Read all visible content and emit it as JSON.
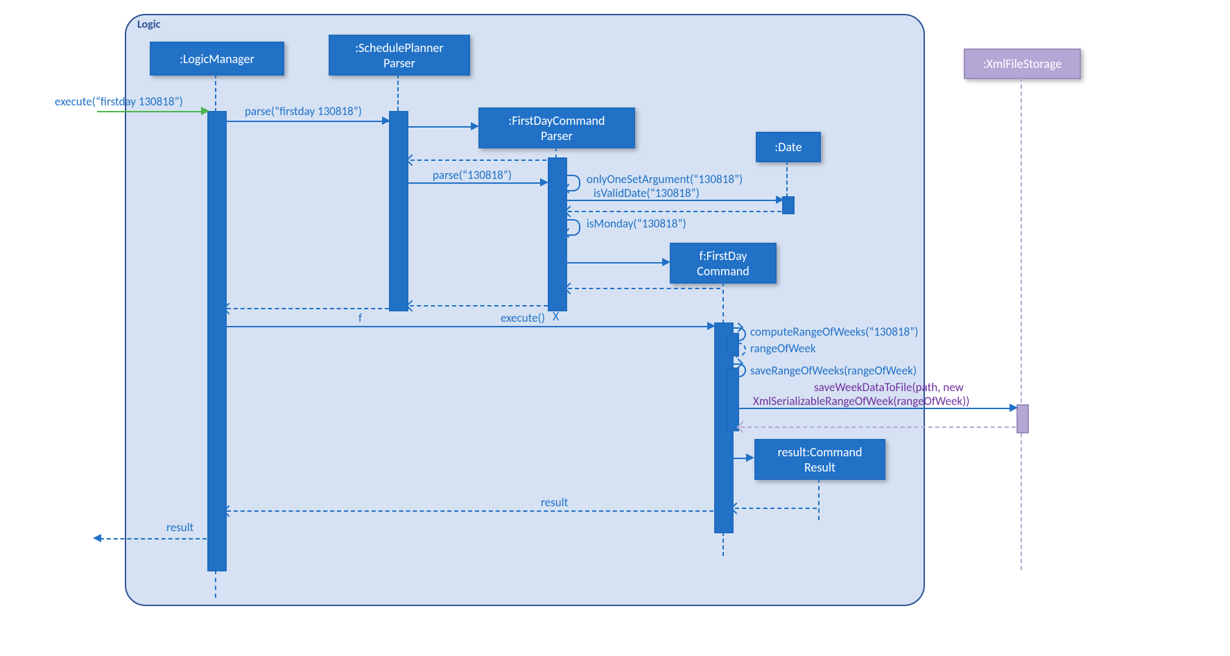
{
  "package": {
    "label": "Logic"
  },
  "lifelines": {
    "lm": ":LogicManager",
    "spp": ":SchedulePlanner\nParser",
    "fdcp": ":FirstDayCommand\nParser",
    "date": ":Date",
    "fdc": "f:FirstDay\nCommand",
    "cr": "result:Command\nResult",
    "xfs": ":XmlFileStorage"
  },
  "messages": {
    "execIn": "execute(“firstday 130818”)",
    "parse1": "parse(“firstday 130818”)",
    "parse2": "parse(“130818”)",
    "onlyOne": "onlyOneSetArgument(“130818”)",
    "isValid": "isValidDate(“130818”)",
    "isMonday": "isMonday(“130818”)",
    "f": "f",
    "executeCall": "execute()",
    "compute": "computeRangeOfWeeks(“130818”)",
    "rangeRet": "rangeOfWeek",
    "saveRange": "saveRangeOfWeeks(rangeOfWeek)",
    "saveFile1": "saveWeekDataToFile(path, new",
    "saveFile2": "XmlSerializableRangeOfWeek(rangeOfWeek))",
    "result": "result",
    "resultOut": "result"
  }
}
